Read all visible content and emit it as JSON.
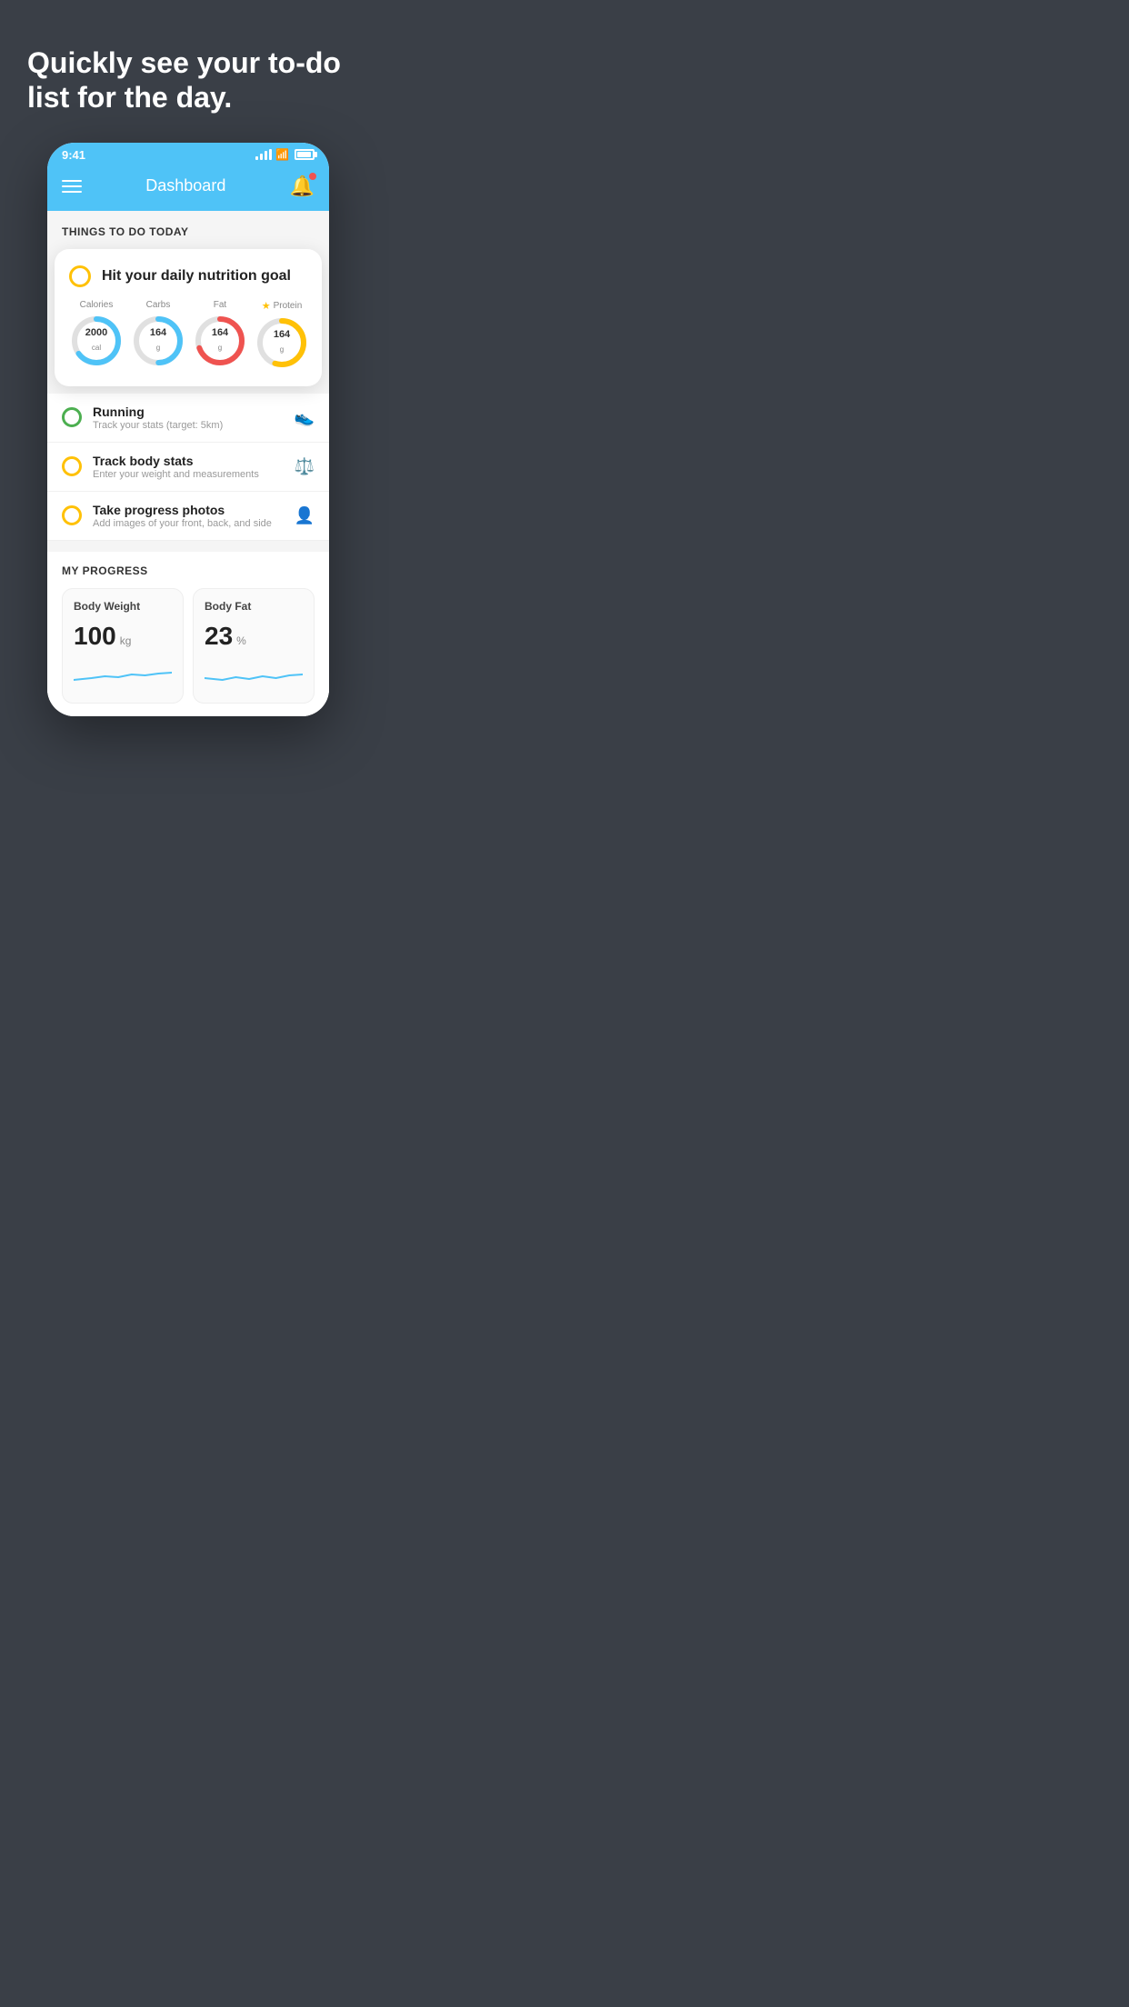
{
  "hero": {
    "title": "Quickly see your to-do list for the day."
  },
  "statusBar": {
    "time": "9:41",
    "timeLabel": "status time"
  },
  "header": {
    "title": "Dashboard"
  },
  "thingsToDoSection": {
    "sectionTitle": "THINGS TO DO TODAY"
  },
  "nutritionCard": {
    "checkCircleColor": "#ffc107",
    "title": "Hit your daily nutrition goal",
    "items": [
      {
        "label": "Calories",
        "value": "2000",
        "unit": "cal",
        "color": "#4fc3f7",
        "progress": 65
      },
      {
        "label": "Carbs",
        "value": "164",
        "unit": "g",
        "color": "#4fc3f7",
        "progress": 50
      },
      {
        "label": "Fat",
        "value": "164",
        "unit": "g",
        "color": "#ef5350",
        "progress": 70
      },
      {
        "label": "Protein",
        "value": "164",
        "unit": "g",
        "color": "#ffc107",
        "progress": 55,
        "hasStar": true
      }
    ]
  },
  "todoItems": [
    {
      "name": "Running",
      "sub": "Track your stats (target: 5km)",
      "circleColor": "green",
      "icon": "🏃"
    },
    {
      "name": "Track body stats",
      "sub": "Enter your weight and measurements",
      "circleColor": "yellow",
      "icon": "⚖️"
    },
    {
      "name": "Take progress photos",
      "sub": "Add images of your front, back, and side",
      "circleColor": "yellow",
      "icon": "👤"
    }
  ],
  "progressSection": {
    "title": "MY PROGRESS",
    "cards": [
      {
        "title": "Body Weight",
        "value": "100",
        "unit": "kg"
      },
      {
        "title": "Body Fat",
        "value": "23",
        "unit": "%"
      }
    ]
  }
}
